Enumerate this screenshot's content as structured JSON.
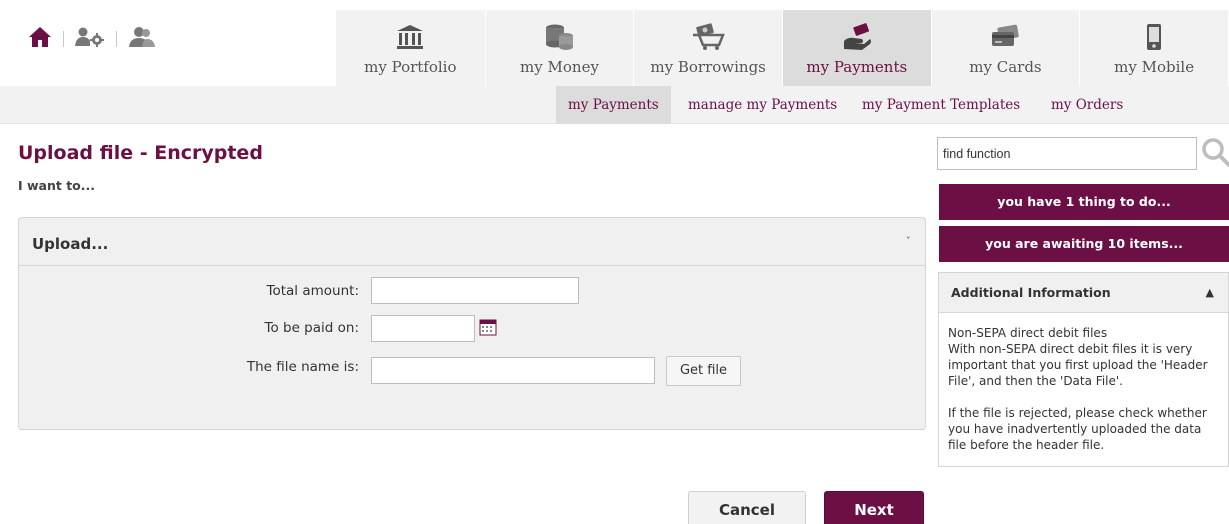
{
  "top_icons": [
    {
      "name": "home-icon"
    },
    {
      "name": "user-settings-icon"
    },
    {
      "name": "users-icon"
    }
  ],
  "main_tabs": [
    {
      "label": "my Portfolio",
      "icon": "bank-icon",
      "active": false
    },
    {
      "label": "my Money",
      "icon": "coins-icon",
      "active": false
    },
    {
      "label": "my Borrowings",
      "icon": "cart-money-icon",
      "active": false
    },
    {
      "label": "my Payments",
      "icon": "hand-payment-icon",
      "active": true
    },
    {
      "label": "my Cards",
      "icon": "cards-icon",
      "active": false
    },
    {
      "label": "my Mobile",
      "icon": "mobile-icon",
      "active": false
    }
  ],
  "subnav": [
    {
      "label": "my Payments",
      "active": true
    },
    {
      "label": "manage my Payments",
      "active": false
    },
    {
      "label": "my Payment Templates",
      "active": false
    },
    {
      "label": "my Orders",
      "active": false
    }
  ],
  "page": {
    "title": "Upload file - Encrypted",
    "subtitle": "I want to..."
  },
  "upload_panel": {
    "title": "Upload...",
    "toggle": "ˇ",
    "fields": {
      "total_amount": {
        "label": "Total amount:",
        "value": ""
      },
      "paid_on": {
        "label": "To be paid on:",
        "value": ""
      },
      "file_name": {
        "label": "The file name is:",
        "value": ""
      }
    },
    "get_file_label": "Get file"
  },
  "actions": {
    "cancel": "Cancel",
    "next": "Next"
  },
  "sidebar": {
    "search_value": "find function",
    "todo": "you have 1 thing to do...",
    "awaiting": "you are awaiting 10 items...",
    "info": {
      "title": "Additional Information",
      "toggle": "▲",
      "heading": "Non-SEPA direct debit files",
      "para1": "With non-SEPA direct debit files it is very important that you first upload the 'Header File', and then the 'Data File'.",
      "para2": "If the file is rejected, please check whether you have inadvertently uploaded the data file before the header file."
    }
  },
  "colors": {
    "brand": "#6b0f45",
    "tab_bg": "#f2f2f2",
    "tab_active_bg": "#dcdcdc"
  }
}
